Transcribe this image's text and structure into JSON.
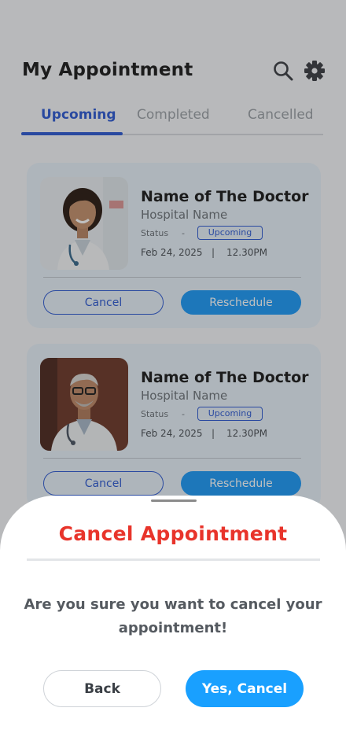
{
  "header": {
    "title": "My Appointment",
    "search_icon": "search-icon",
    "settings_icon": "gear-icon"
  },
  "tabs": [
    {
      "label": "Upcoming",
      "active": true
    },
    {
      "label": "Completed",
      "active": false
    },
    {
      "label": "Cancelled",
      "active": false
    }
  ],
  "appointments": [
    {
      "doctor_name": "Name of The Doctor",
      "hospital": "Hospital Name",
      "status_label": "Status",
      "status_dash": "-",
      "status": "Upcoming",
      "date": "Feb 24, 2025",
      "separator": "|",
      "time": "12.30PM",
      "cancel_label": "Cancel",
      "reschedule_label": "Reschedule"
    },
    {
      "doctor_name": "Name of The Doctor",
      "hospital": "Hospital Name",
      "status_label": "Status",
      "status_dash": "-",
      "status": "Upcoming",
      "date": "Feb 24, 2025",
      "separator": "|",
      "time": "12.30PM",
      "cancel_label": "Cancel",
      "reschedule_label": "Reschedule"
    }
  ],
  "dialog": {
    "title": "Cancel Appointment",
    "message": "Are you sure you want to cancel your appointment!",
    "back_label": "Back",
    "confirm_label": "Yes, Cancel"
  },
  "colors": {
    "accent_blue": "#2f5bd3",
    "button_blue": "#1e9af7",
    "danger_red": "#e8342b",
    "card_bg": "#e7f0f8"
  }
}
